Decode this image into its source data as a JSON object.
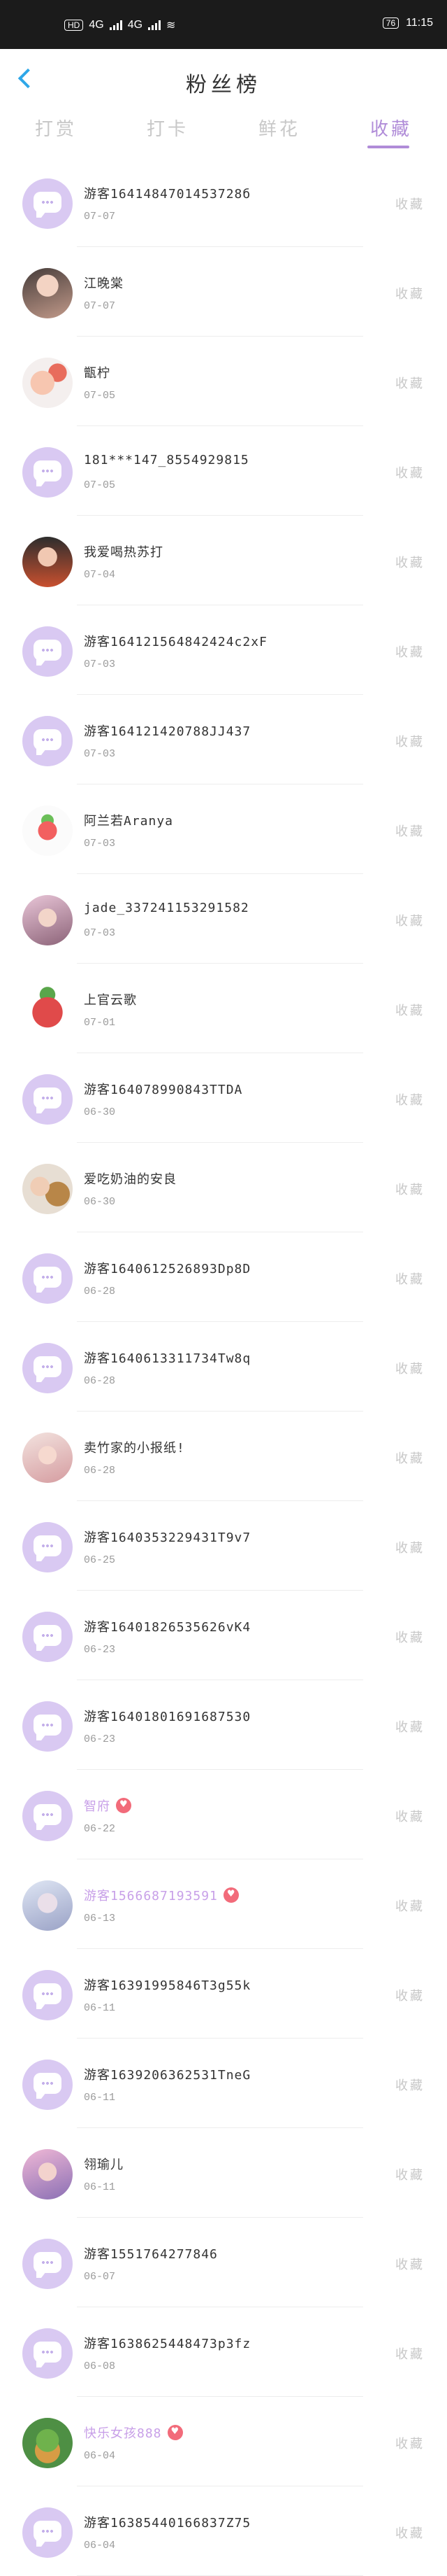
{
  "status_bar": {
    "left_badge": "HD",
    "net_1": "4G",
    "net_2": "4G",
    "battery": "76",
    "time": "11:15"
  },
  "header": {
    "title": "粉丝榜"
  },
  "tabs": [
    {
      "label": "打赏",
      "active": false
    },
    {
      "label": "打卡",
      "active": false
    },
    {
      "label": "鲜花",
      "active": false
    },
    {
      "label": "收藏",
      "active": true
    }
  ],
  "action_label": "收藏",
  "items": [
    {
      "name": "游客1641484701453728б",
      "date": "07-07",
      "avatar": "chat",
      "vip": false
    },
    {
      "name": "江晚棠",
      "date": "07-07",
      "avatar": "photo",
      "vip": false
    },
    {
      "name": "甑柠",
      "date": "07-05",
      "avatar": "photo",
      "vip": false
    },
    {
      "name": "181***147_8554929815",
      "date": "07-05",
      "avatar": "chat",
      "vip": false
    },
    {
      "name": "我爱喝热苏打",
      "date": "07-04",
      "avatar": "photo",
      "vip": false
    },
    {
      "name": "游客164121564842424c2xF",
      "date": "07-03",
      "avatar": "chat",
      "vip": false
    },
    {
      "name": "游客164121420788JJ437",
      "date": "07-03",
      "avatar": "chat",
      "vip": false
    },
    {
      "name": "阿兰若Aranya",
      "date": "07-03",
      "avatar": "photo",
      "vip": false
    },
    {
      "name": "jade_337241153291582",
      "date": "07-03",
      "avatar": "photo",
      "vip": false
    },
    {
      "name": "上官云歌",
      "date": "07-01",
      "avatar": "photo",
      "vip": false
    },
    {
      "name": "游客164078990843TTDA",
      "date": "06-30",
      "avatar": "chat",
      "vip": false
    },
    {
      "name": "爱吃奶油的安良",
      "date": "06-30",
      "avatar": "photo",
      "vip": false
    },
    {
      "name": "游客1640612526893Dp8D",
      "date": "06-28",
      "avatar": "chat",
      "vip": false
    },
    {
      "name": "游客1640613311734Tw8q",
      "date": "06-28",
      "avatar": "chat",
      "vip": false
    },
    {
      "name": "卖竹家的小报纸!",
      "date": "06-28",
      "avatar": "photo",
      "vip": false
    },
    {
      "name": "游客1640353229431T9v7",
      "date": "06-25",
      "avatar": "chat",
      "vip": false
    },
    {
      "name": "游客16401826535626vK4",
      "date": "06-23",
      "avatar": "chat",
      "vip": false
    },
    {
      "name": "游客16401801691687530",
      "date": "06-23",
      "avatar": "chat",
      "vip": false
    },
    {
      "name": "智府",
      "date": "06-22",
      "avatar": "chat",
      "vip": true
    },
    {
      "name": "游客1566687193591",
      "date": "06-13",
      "avatar": "photo",
      "vip": true
    },
    {
      "name": "游客16391995846T3g55k",
      "date": "06-11",
      "avatar": "chat",
      "vip": false
    },
    {
      "name": "游客1639206362531TneG",
      "date": "06-11",
      "avatar": "chat",
      "vip": false
    },
    {
      "name": "翎瑜儿",
      "date": "06-11",
      "avatar": "photo",
      "vip": false
    },
    {
      "name": "游客1551764277846",
      "date": "06-07",
      "avatar": "chat",
      "vip": false
    },
    {
      "name": "游客1638625448473p3fz",
      "date": "06-08",
      "avatar": "chat",
      "vip": false
    },
    {
      "name": "快乐女孩888",
      "date": "06-04",
      "avatar": "photo",
      "vip": true
    },
    {
      "name": "游客163854401668З7Z75",
      "date": "06-04",
      "avatar": "chat",
      "vip": false
    }
  ]
}
